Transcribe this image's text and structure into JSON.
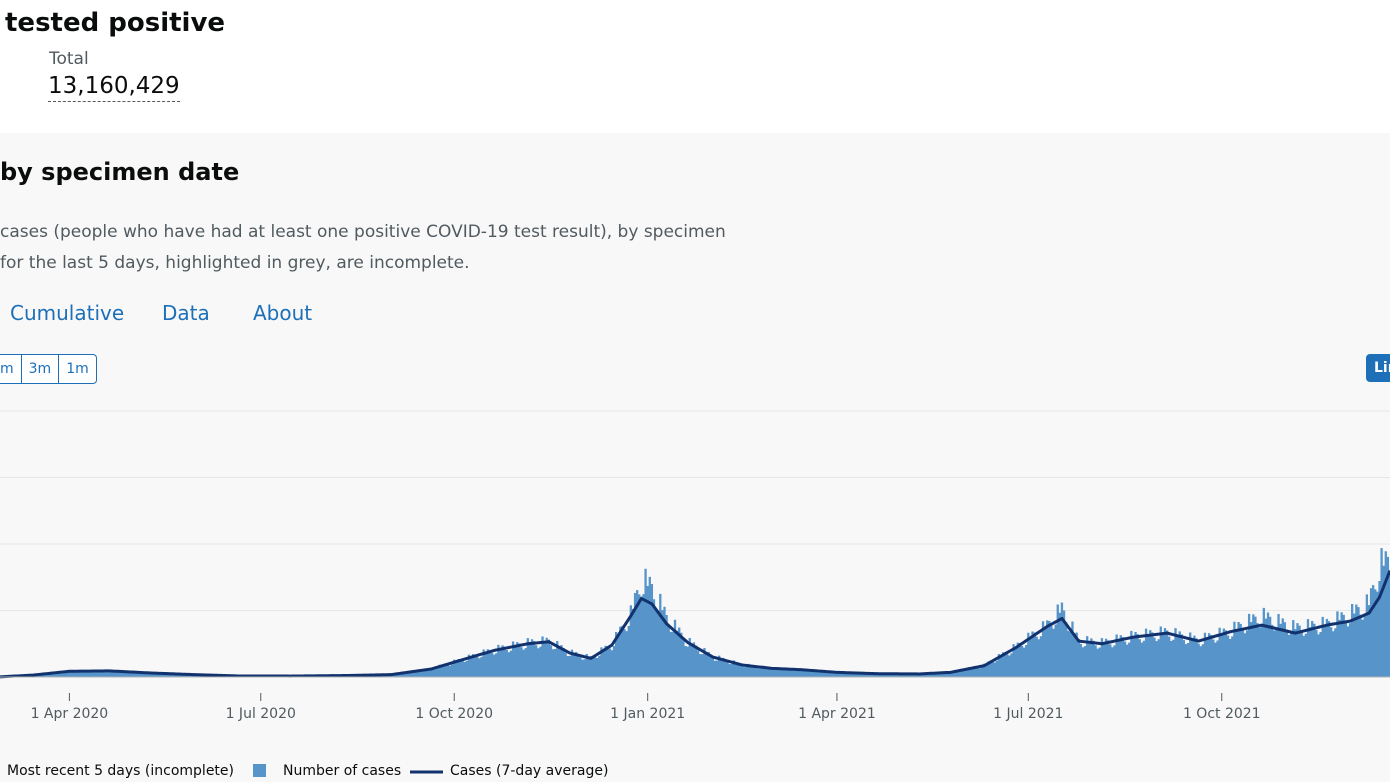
{
  "header": {
    "title": "tested positive",
    "total_label": "Total",
    "total_value": "13,160,429"
  },
  "panel": {
    "title": "by specimen date",
    "description_lines": [
      "cases (people who have had at least one positive COVID-19 test result), by specimen",
      "for the last 5 days, highlighted in grey, are incomplete."
    ],
    "tabs": [
      "Cumulative",
      "Data",
      "About"
    ],
    "range_buttons": [
      "m",
      "3m",
      "1m"
    ],
    "scale_button": "Lin"
  },
  "colors": {
    "bars": "#5694ca",
    "line": "#12326e",
    "link": "#1d70b8",
    "panel_bg": "#f8f8f8",
    "grid": "#e6e6e6"
  },
  "chart_data": {
    "type": "bar",
    "x_ticks": [
      "1 Apr 2020",
      "1 Jul 2020",
      "1 Oct 2020",
      "1 Jan 2021",
      "1 Apr 2021",
      "1 Jul 2021",
      "1 Oct 2021"
    ],
    "x_range": [
      "2020-02-28",
      "2021-12-20"
    ],
    "y_range": [
      0,
      200000
    ],
    "grid": true,
    "series": [
      {
        "name": "Number of cases",
        "style": "bars",
        "points": [
          [
            "2020-02-28",
            100
          ],
          [
            "2020-03-15",
            1500
          ],
          [
            "2020-04-01",
            4300
          ],
          [
            "2020-04-20",
            4600
          ],
          [
            "2020-05-10",
            3000
          ],
          [
            "2020-06-01",
            1700
          ],
          [
            "2020-06-20",
            800
          ],
          [
            "2020-07-15",
            700
          ],
          [
            "2020-08-10",
            1100
          ],
          [
            "2020-09-01",
            1800
          ],
          [
            "2020-09-20",
            6000
          ],
          [
            "2020-10-05",
            13000
          ],
          [
            "2020-10-20",
            20000
          ],
          [
            "2020-11-05",
            25000
          ],
          [
            "2020-11-15",
            26500
          ],
          [
            "2020-11-25",
            18000
          ],
          [
            "2020-12-05",
            14000
          ],
          [
            "2020-12-15",
            24000
          ],
          [
            "2020-12-24",
            46000
          ],
          [
            "2020-12-29",
            72000
          ],
          [
            "2021-01-03",
            66000
          ],
          [
            "2021-01-10",
            44000
          ],
          [
            "2021-01-20",
            26000
          ],
          [
            "2021-02-01",
            15000
          ],
          [
            "2021-02-15",
            9000
          ],
          [
            "2021-03-01",
            6500
          ],
          [
            "2021-03-15",
            5500
          ],
          [
            "2021-04-01",
            3500
          ],
          [
            "2021-04-20",
            2500
          ],
          [
            "2021-05-10",
            2300
          ],
          [
            "2021-05-25",
            3500
          ],
          [
            "2021-06-10",
            8500
          ],
          [
            "2021-06-25",
            22000
          ],
          [
            "2021-07-10",
            38000
          ],
          [
            "2021-07-17",
            50000
          ],
          [
            "2021-07-25",
            27000
          ],
          [
            "2021-08-05",
            25000
          ],
          [
            "2021-08-20",
            30000
          ],
          [
            "2021-09-05",
            33000
          ],
          [
            "2021-09-20",
            27000
          ],
          [
            "2021-10-05",
            34000
          ],
          [
            "2021-10-20",
            45000
          ],
          [
            "2021-11-05",
            36000
          ],
          [
            "2021-11-20",
            39000
          ],
          [
            "2021-12-01",
            46000
          ],
          [
            "2021-12-10",
            54000
          ],
          [
            "2021-12-15",
            82000
          ],
          [
            "2021-12-20",
            86000
          ]
        ]
      },
      {
        "name": "Cases (7-day average)",
        "style": "line",
        "points": [
          [
            "2020-02-28",
            100
          ],
          [
            "2020-03-15",
            1500
          ],
          [
            "2020-04-01",
            4300
          ],
          [
            "2020-04-20",
            4600
          ],
          [
            "2020-05-10",
            3000
          ],
          [
            "2020-06-01",
            1700
          ],
          [
            "2020-06-20",
            800
          ],
          [
            "2020-07-15",
            700
          ],
          [
            "2020-08-10",
            1100
          ],
          [
            "2020-09-01",
            1800
          ],
          [
            "2020-09-20",
            6000
          ],
          [
            "2020-10-05",
            13000
          ],
          [
            "2020-10-20",
            20000
          ],
          [
            "2020-11-05",
            25000
          ],
          [
            "2020-11-15",
            26500
          ],
          [
            "2020-11-25",
            18000
          ],
          [
            "2020-12-05",
            14000
          ],
          [
            "2020-12-15",
            24000
          ],
          [
            "2020-12-24",
            46000
          ],
          [
            "2020-12-29",
            59000
          ],
          [
            "2021-01-03",
            55000
          ],
          [
            "2021-01-10",
            40000
          ],
          [
            "2021-01-20",
            26000
          ],
          [
            "2021-02-01",
            15000
          ],
          [
            "2021-02-15",
            9000
          ],
          [
            "2021-03-01",
            6500
          ],
          [
            "2021-03-15",
            5500
          ],
          [
            "2021-04-01",
            3500
          ],
          [
            "2021-04-20",
            2500
          ],
          [
            "2021-05-10",
            2300
          ],
          [
            "2021-05-25",
            3500
          ],
          [
            "2021-06-10",
            8500
          ],
          [
            "2021-06-25",
            22000
          ],
          [
            "2021-07-10",
            38000
          ],
          [
            "2021-07-17",
            44000
          ],
          [
            "2021-07-25",
            27000
          ],
          [
            "2021-08-05",
            25000
          ],
          [
            "2021-08-20",
            30000
          ],
          [
            "2021-09-05",
            33000
          ],
          [
            "2021-09-20",
            27000
          ],
          [
            "2021-10-05",
            34000
          ],
          [
            "2021-10-20",
            39000
          ],
          [
            "2021-11-05",
            33000
          ],
          [
            "2021-11-20",
            39000
          ],
          [
            "2021-12-01",
            42000
          ],
          [
            "2021-12-10",
            48000
          ],
          [
            "2021-12-15",
            60000
          ],
          [
            "2021-12-20",
            80000
          ]
        ]
      }
    ],
    "legend": [
      "Most recent 5 days (incomplete)",
      "Number of cases",
      "Cases (7-day average)"
    ],
    "legend_position": "bottom-left"
  }
}
